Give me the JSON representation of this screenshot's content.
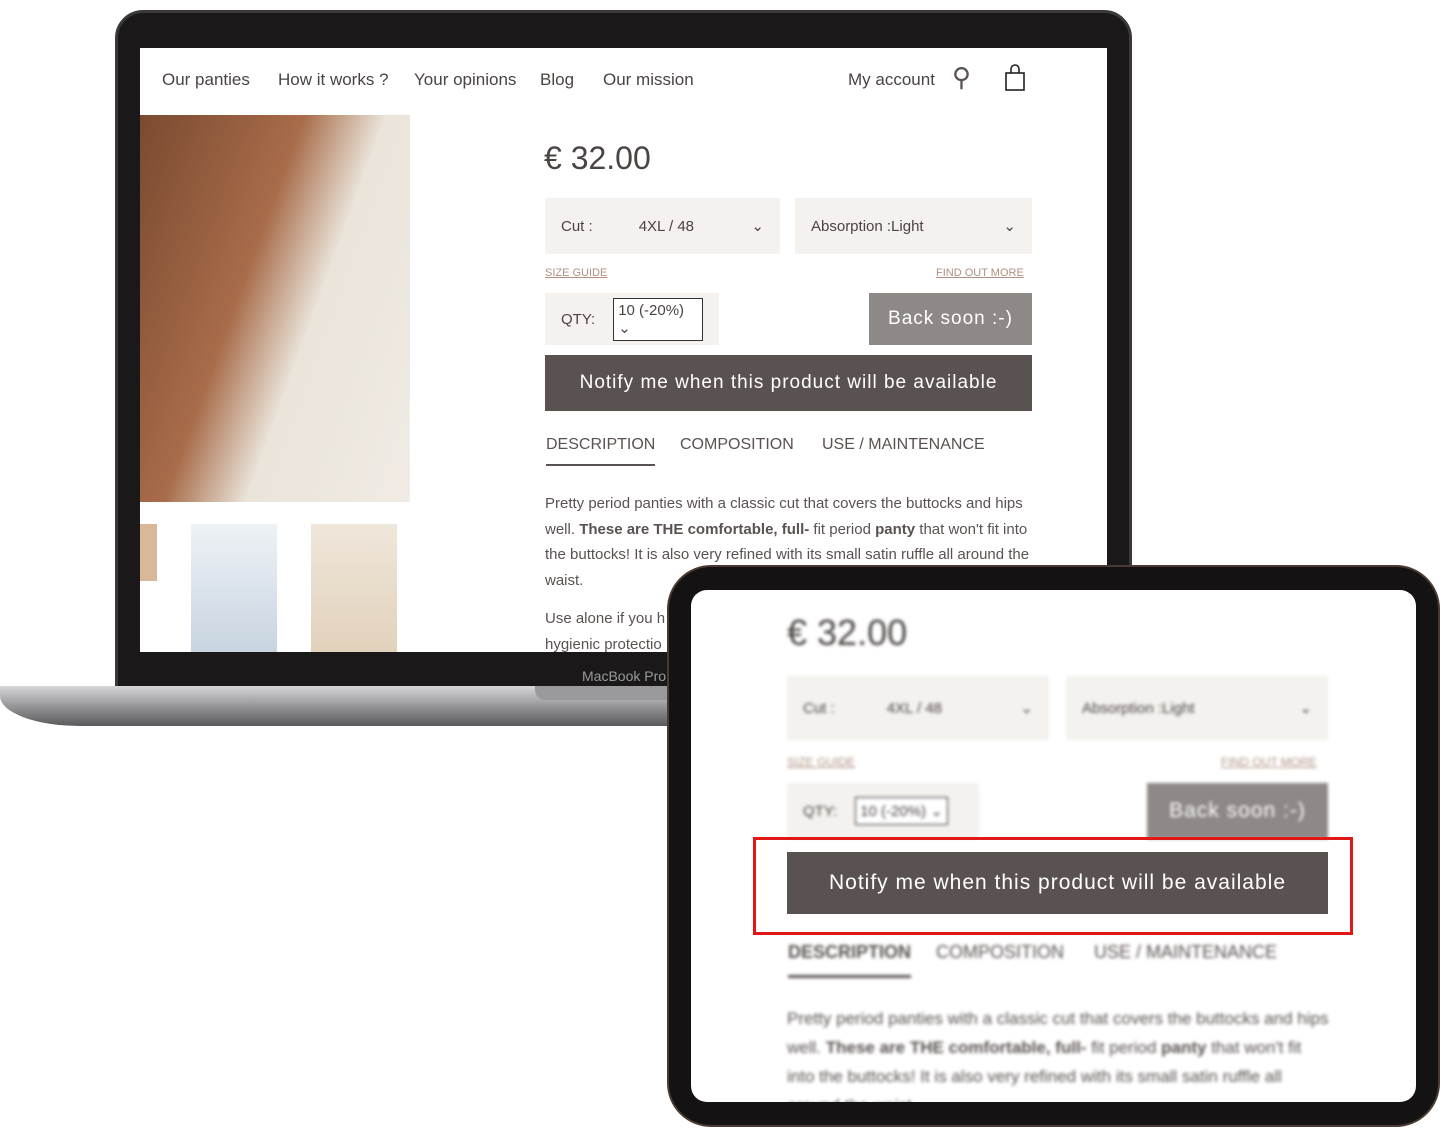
{
  "nav": {
    "items": [
      "Our panties",
      "How it works ?",
      "Your opinions",
      "Blog",
      "Our mission"
    ],
    "account": "My account",
    "search_icon": "search-icon",
    "cart_icon": "shopping-bag-icon"
  },
  "product": {
    "price": "€ 32.00",
    "cut_label": "Cut :",
    "cut_value": "4XL / 48",
    "absorption": "Absorption :Light",
    "size_guide": "SIZE GUIDE",
    "find_out_more": "FIND OUT MORE",
    "qty_label": "QTY:",
    "qty_value": "10 (-20%)",
    "back_soon": "Back soon :-)",
    "notify": "Notify me when this product will be available"
  },
  "tabs": [
    "DESCRIPTION",
    "COMPOSITION",
    "USE / MAINTENANCE"
  ],
  "description": {
    "p1_a": "Pretty period panties with a classic cut that covers the buttocks and hips well. ",
    "p1_b": "These are THE comfortable, full-",
    "p1_c": " fit period ",
    "p1_d": "panty",
    "p1_e": " that won't fit into the buttocks! It is also very refined with its small satin ruffle all around the waist.",
    "p2": "Use alone if you h",
    "p3": "hygienic protectio"
  },
  "device": {
    "brand": "MacBook Pro"
  },
  "colors": {
    "button_dark": "#5a5250",
    "button_grey": "#8e8886",
    "highlight": "#e01818"
  }
}
